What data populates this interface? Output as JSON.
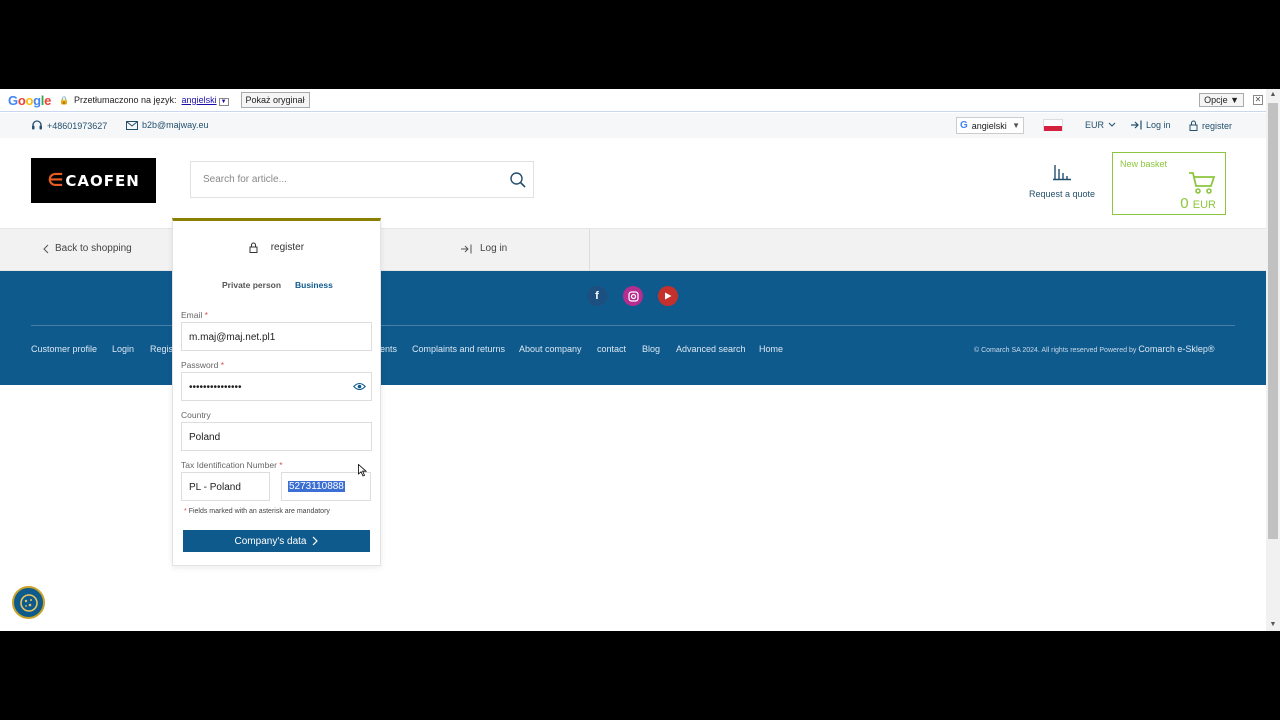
{
  "translate_bar": {
    "logo": [
      "G",
      "o",
      "o",
      "g",
      "l",
      "e"
    ],
    "translated_to": "Przetłumaczono na język:",
    "language": "angielski",
    "show_original": "Pokaż oryginał",
    "options": "Opcje ▼",
    "close": "✕"
  },
  "topbar": {
    "phone": "+48601973627",
    "email": "b2b@majway.eu",
    "language": "angielski",
    "currency": "EUR",
    "login": "Log in",
    "register": "register"
  },
  "header": {
    "logo": "CAOFEN",
    "search_placeholder": "Search for article...",
    "quote_label": "Request a quote",
    "basket_title": "New basket",
    "basket_amount": "0",
    "basket_currency": "EUR"
  },
  "navrow": {
    "back": "Back to shopping",
    "login": "Log in"
  },
  "footer": {
    "links": [
      "Customer profile",
      "Login",
      "Regis",
      "ents",
      "Complaints and returns",
      "About company",
      "contact",
      "Blog",
      "Advanced search",
      "Home"
    ],
    "copyright": "© Comarch SA 2024. All rights reserved Powered by",
    "powered": "Comarch e-Sklep®"
  },
  "register_panel": {
    "title": "register",
    "tab_private": "Private person",
    "tab_business": "Business",
    "email_label": "Email",
    "email_value": "m.maj@maj.net.pl1",
    "password_label": "Password",
    "password_value": "•••••••••••••••",
    "country_label": "Country",
    "country_value": "Poland",
    "tax_label": "Tax Identification Number",
    "tax_country": "PL - Poland",
    "tax_number": "5273110888",
    "required_mark": "*",
    "mandatory_note": "Fields marked with an asterisk are mandatory",
    "submit": "Company's data"
  },
  "colors": {
    "brand_blue": "#0f5a8d",
    "basket_green": "#8cc63f",
    "panel_accent": "#8a8000"
  }
}
